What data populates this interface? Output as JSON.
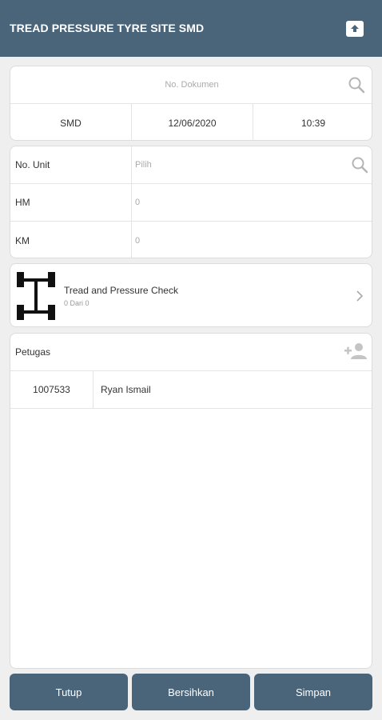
{
  "header": {
    "title": "TREAD PRESSURE TYRE SITE SMD",
    "upload_icon": "upload-icon"
  },
  "document": {
    "placeholder": "No. Dokumen",
    "site": "SMD",
    "date": "12/06/2020",
    "time": "10:39"
  },
  "unit": {
    "label": "No. Unit",
    "placeholder": "Pilih",
    "hm_label": "HM",
    "hm_value": "0",
    "km_label": "KM",
    "km_value": "0"
  },
  "check": {
    "title": "Tread and Pressure Check",
    "subtitle": "0 Dari 0"
  },
  "petugas": {
    "label": "Petugas",
    "rows": [
      {
        "id": "1007533",
        "name": "Ryan Ismail"
      }
    ]
  },
  "buttons": {
    "tutup": "Tutup",
    "bersihkan": "Bersihkan",
    "simpan": "Simpan"
  },
  "colors": {
    "primary": "#4a647a",
    "background": "#efefef"
  }
}
